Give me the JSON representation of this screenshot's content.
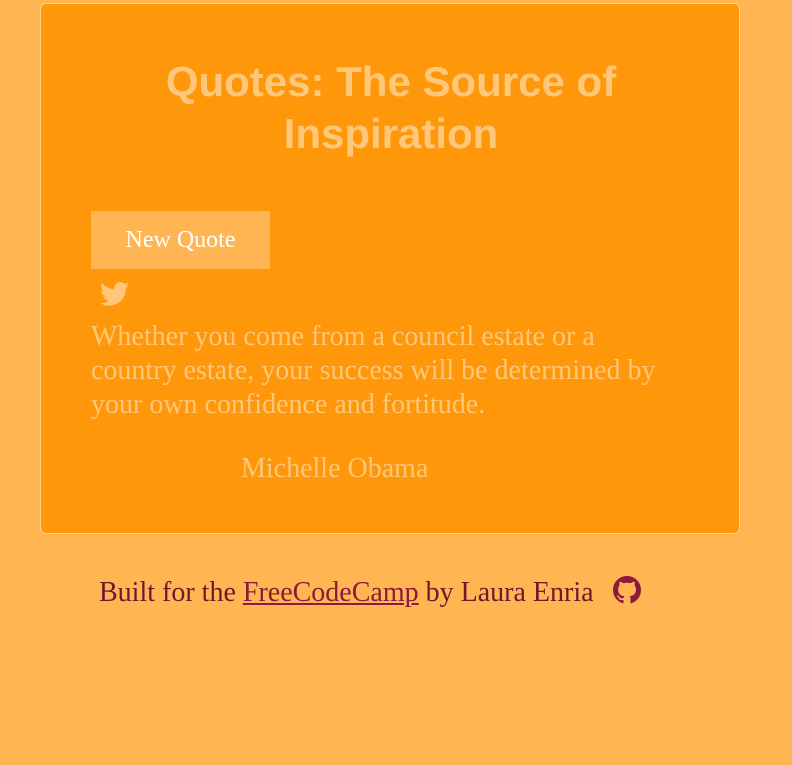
{
  "card": {
    "title": "Quotes: The Source of Inspiration",
    "new_quote_label": "New Quote",
    "tweet_icon": "twitter-icon",
    "quote_text": "Whether you come from a council estate or a country estate, your success will be determined by your own confidence and fortitude.",
    "quote_author": "Michelle Obama"
  },
  "footer": {
    "prefix": "Built for the",
    "link_text": "FreeCodeCamp",
    "suffix": "by Laura Enria",
    "github_icon": "github-icon"
  },
  "colors": {
    "background": "#ffb652",
    "card": "#ff970b",
    "muted_text": "#ffc77a",
    "footer_text": "#6b1a2c",
    "link": "#8b1a3c"
  }
}
